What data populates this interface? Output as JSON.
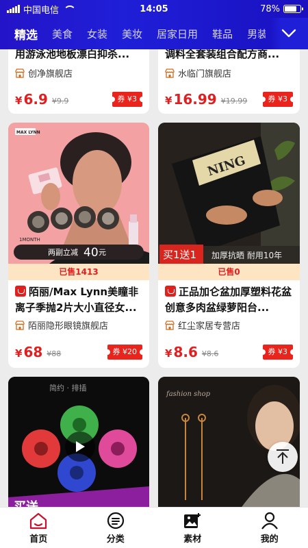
{
  "status_bar": {
    "carrier": "中国电信",
    "time": "14:05",
    "battery": "78%",
    "battery_level": 0.78
  },
  "tabs": {
    "items": [
      "精选",
      "美食",
      "女装",
      "美妆",
      "居家日用",
      "鞋品",
      "男装"
    ],
    "active_index": 0,
    "more_icon": "chevron-down-icon"
  },
  "accent": {
    "brand_blue": "#1f1fd8",
    "price_red": "#e02020",
    "coupon_red": "#e8241c"
  },
  "products": [
    {
      "title_partial": "用游泳池地板漂白抑杀...",
      "shop": "创净旗舰店",
      "price_symbol": "¥",
      "price": "6.9",
      "original": "¥9.9",
      "coupon": "券 ¥3"
    },
    {
      "title_partial": "调料全套装组合配方商...",
      "shop": "水临门旗舰店",
      "price_symbol": "¥",
      "price": "16.99",
      "original": "¥19.99",
      "coupon": "券 ¥3"
    },
    {
      "title": "陌丽/Max Lynn美瞳非离子季抛2片大小直径女...",
      "shop": "陌丽隐形眼镜旗舰店",
      "sold": "已售1413",
      "price_symbol": "¥",
      "price": "68",
      "original": "¥88",
      "coupon": "券 ¥20",
      "image_text": {
        "brand": "MAX LYNN",
        "month": "1MONTH",
        "promo": "两副立减",
        "promo_amount": "40",
        "promo_unit": "元"
      }
    },
    {
      "title": "正品加仑盆加厚塑料花盆创意多肉盆绿萝阳台...",
      "shop": "红尘家居专营店",
      "sold": "已售0",
      "price_symbol": "¥",
      "price": "8.6",
      "original": "¥8.6",
      "coupon": "券 ¥3",
      "image_text": {
        "badge": "买1送1",
        "caption": "加厚抗晒 耐用10年",
        "pot_text": "NING"
      }
    },
    {
      "image_text": {
        "top": "简约 · 排插",
        "bottom": "买送"
      }
    },
    {
      "image_text": {
        "top": "fashion shop"
      }
    }
  ],
  "bottom_nav": {
    "items": [
      {
        "label": "首页",
        "icon": "home-icon"
      },
      {
        "label": "分类",
        "icon": "category-icon"
      },
      {
        "label": "素材",
        "icon": "material-image-icon"
      },
      {
        "label": "我的",
        "icon": "user-icon"
      }
    ]
  }
}
